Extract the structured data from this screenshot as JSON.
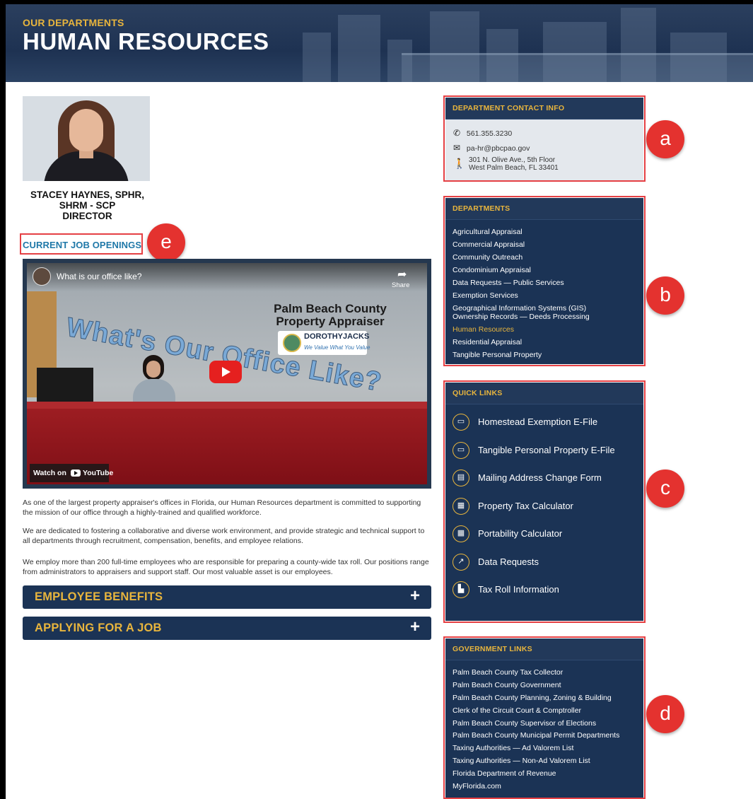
{
  "hero": {
    "eyebrow": "OUR DEPARTMENTS",
    "title": "HUMAN RESOURCES"
  },
  "director": {
    "name_line1": "STACEY HAYNES, SPHR,",
    "name_line2": "SHRM - SCP",
    "title": "DIRECTOR"
  },
  "job_link": "CURRENT JOB OPENINGS",
  "video": {
    "title": "What is our office like?",
    "share_label": "Share",
    "watch_on": "Watch on",
    "youtube_label": "YouTube",
    "sign_title": "Palm Beach County Property Appraiser",
    "sign_name": "DOROTHYJACKS",
    "sign_tagline": "We Value What You Value",
    "overlay_text": "What's Our Office Like?"
  },
  "paragraphs": [
    "As one of the largest property appraiser's offices in Florida, our Human Resources department is committed to supporting the mission of our office through a highly-trained and qualified workforce.",
    "We are dedicated to fostering a collaborative and diverse work environment, and provide strategic and technical support to all departments through recruitment, compensation, benefits, and employee relations.",
    "We employ more than 200 full-time employees who are responsible for preparing a county-wide tax roll. Our positions range from administrators to appraisers and support staff. Our most valuable asset is our employees."
  ],
  "accordions": [
    {
      "label": "EMPLOYEE BENEFITS",
      "icon": "+"
    },
    {
      "label": "APPLYING FOR A JOB",
      "icon": "+"
    }
  ],
  "contact": {
    "heading": "DEPARTMENT CONTACT INFO",
    "phone": "561.355.3230",
    "email": "pa-hr@pbcpao.gov",
    "address_line1": "301 N. Olive Ave., 5th Floor",
    "address_line2": "West Palm Beach, FL 33401"
  },
  "departments": {
    "heading": "DEPARTMENTS",
    "items": [
      "Agricultural Appraisal",
      "Commercial Appraisal",
      "Community Outreach",
      "Condominium Appraisal",
      "Data Requests — Public Services",
      "Exemption Services",
      "Geographical Information Systems (GIS)",
      "Ownership Records — Deeds Processing",
      "Human Resources",
      "Residential Appraisal",
      "Tangible Personal Property"
    ],
    "active": "Human Resources"
  },
  "quick_links": {
    "heading": "QUICK LINKS",
    "items": [
      {
        "label": "Homestead Exemption E-File",
        "icon": "laptop-icon"
      },
      {
        "label": "Tangible Personal Property E-File",
        "icon": "laptop-icon"
      },
      {
        "label": "Mailing Address Change Form",
        "icon": "address-card-icon"
      },
      {
        "label": "Property Tax Calculator",
        "icon": "calculator-icon"
      },
      {
        "label": "Portability Calculator",
        "icon": "calculator-icon"
      },
      {
        "label": "Data Requests",
        "icon": "chart-icon"
      },
      {
        "label": "Tax Roll Information",
        "icon": "document-icon"
      }
    ]
  },
  "government_links": {
    "heading": "GOVERNMENT LINKS",
    "items": [
      "Palm Beach County Tax Collector",
      "Palm Beach County Government",
      "Palm Beach County Planning, Zoning & Building",
      "Clerk of the Circuit Court & Comptroller",
      "Palm Beach County Supervisor of Elections",
      "Palm Beach County Municipal Permit Departments",
      "Taxing Authorities — Ad Valorem List",
      "Taxing Authorities — Non-Ad Valorem List",
      "Florida Department of Revenue",
      "MyFlorida.com"
    ]
  },
  "annotations": {
    "a": "a",
    "b": "b",
    "c": "c",
    "d": "d",
    "e": "e"
  },
  "colors": {
    "navy": "#1b3355",
    "gold": "#e8b53d",
    "link_blue": "#1f78a8",
    "highlight_red": "#e54044"
  }
}
